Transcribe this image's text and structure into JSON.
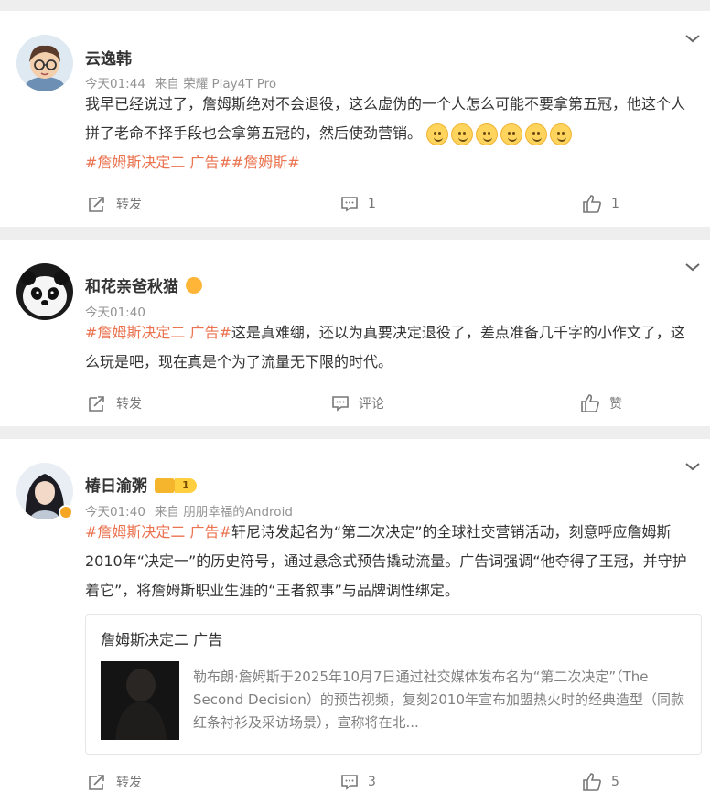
{
  "posts": [
    {
      "user": "云逸韩",
      "time": "今天01:44",
      "source": "来自 荣耀 Play4T Pro",
      "text_1": "我早已经说过了，詹姆斯绝对不会退役，这么虚伪的一个人怎么可能不要拿第五冠，他这个人拼了老命不择手段也会拿第五冠的，然后使劲营销。",
      "tags": "#詹姆斯决定二 广告##詹姆斯#",
      "repost": "转发",
      "comments": "1",
      "likes": "1"
    },
    {
      "user": "和花亲爸秋猫",
      "time": "今天01:40",
      "tag": "#詹姆斯决定二 广告#",
      "text": "这是真难绷，还以为真要决定退役了，差点准备几千字的小作文了，这么玩是吧，现在真是个为了流量无下限的时代。",
      "repost": "转发",
      "comments": "评论",
      "likes": "赞"
    },
    {
      "user": "椿日渝粥",
      "level": "1",
      "time": "今天01:40",
      "source": "来自 朋朋幸福的Android",
      "tag": "#詹姆斯决定二 广告#",
      "text": "轩尼诗发起名为“第二次决定”的全球社交营销活动，刻意呼应詹姆斯2010年“决定一”的历史符号，通过悬念式预告撬动流量。广告词强调“他夺得了王冠，并守护着它”，将詹姆斯职业生涯的“王者叙事”与品牌调性绑定。",
      "quote_title": "詹姆斯决定二 广告",
      "quote_text": "勒布朗·詹姆斯于2025年10月7日通过社交媒体发布名为“第二次决定”（The Second Decision）的预告视频，复刻2010年宣布加盟热火时的经典造型（同款红条衬衫及采访场景），宣称将在北...",
      "repost": "转发",
      "comments": "3",
      "likes": "5"
    }
  ],
  "icons": {
    "repost": "repost-icon",
    "comment": "comment-icon",
    "like": "like-icon",
    "more": "chevron-down-icon"
  },
  "colors": {
    "tag": "#eb7350",
    "meta": "#939393",
    "background": "#eeeeee"
  }
}
